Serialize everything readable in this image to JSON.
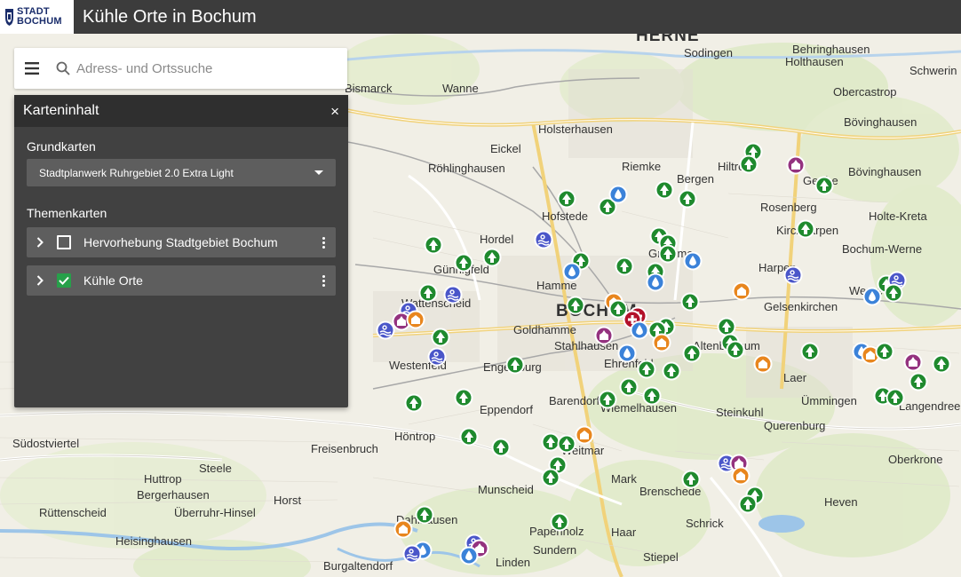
{
  "header": {
    "logo_line1": "STADT",
    "logo_line2": "BOCHUM",
    "title": "Kühle Orte in Bochum"
  },
  "search": {
    "placeholder": "Adress- und Ortssuche"
  },
  "panel": {
    "title": "Karteninhalt",
    "close": "×",
    "basemaps_label": "Grundkarten",
    "basemap_selected": "Stadtplanwerk Ruhrgebiet 2.0 Extra Light",
    "themes_label": "Themenkarten",
    "layers": [
      {
        "label": "Hervorhebung Stadtgebiet Bochum",
        "checked": false
      },
      {
        "label": "Kühle Orte",
        "checked": true
      }
    ]
  },
  "colors": {
    "header_bg": "#3c3c3c",
    "panel_bg": "#414141",
    "row_bg": "#5e5e5e",
    "check_green": "#27a04a",
    "pin_green": "#1f8a2e",
    "pin_blue_water": "#3b82d9",
    "pin_pool": "#4a56c9",
    "pin_orange": "#e8861e",
    "pin_purple": "#94327f",
    "pin_red": "#b3112a"
  },
  "map": {
    "labels": [
      {
        "text": "HERNE",
        "big": true
      },
      {
        "text": "Sodingen"
      },
      {
        "text": "Behringhausen"
      },
      {
        "text": "Holthausen"
      },
      {
        "text": "Schwerin"
      },
      {
        "text": "Bismarck"
      },
      {
        "text": "Wanne"
      },
      {
        "text": "Obercastrop"
      },
      {
        "text": "Bövinghausen"
      },
      {
        "text": "Holsterhausen"
      },
      {
        "text": "Eickel"
      },
      {
        "text": "Röhlinghausen"
      },
      {
        "text": "Riemke"
      },
      {
        "text": "Bergen"
      },
      {
        "text": "Hiltrop"
      },
      {
        "text": "Gerthe"
      },
      {
        "text": "Bövinghausen"
      },
      {
        "text": "Hofstede"
      },
      {
        "text": "Rosenberg"
      },
      {
        "text": "Kirchharpen"
      },
      {
        "text": "Hordel"
      },
      {
        "text": "Grumme"
      },
      {
        "text": "Harpen"
      },
      {
        "text": "Günnigfeld"
      },
      {
        "text": "Hamme"
      },
      {
        "text": "Wattenscheid"
      },
      {
        "text": "BOCHUM",
        "big": true
      },
      {
        "text": "Goldhamme"
      },
      {
        "text": "Stahlhausen"
      },
      {
        "text": "Altenbochum"
      },
      {
        "text": "Westenfeld"
      },
      {
        "text": "Engelsburg"
      },
      {
        "text": "Ehrenfeld"
      },
      {
        "text": "Laer"
      },
      {
        "text": "Langendreer"
      },
      {
        "text": "Eppendorf"
      },
      {
        "text": "Wiemelhausen"
      },
      {
        "text": "Ümmingen"
      },
      {
        "text": "Südostviertel"
      },
      {
        "text": "Freisenbruch"
      },
      {
        "text": "Höntrop"
      },
      {
        "text": "Weitmar"
      },
      {
        "text": "Querenburg"
      },
      {
        "text": "Steele"
      },
      {
        "text": "Huttrop"
      },
      {
        "text": "Bergerhausen"
      },
      {
        "text": "Mark"
      },
      {
        "text": "Brenschede"
      },
      {
        "text": "Rüttenscheid"
      },
      {
        "text": "Überruhr-Hinsel"
      },
      {
        "text": "Horst"
      },
      {
        "text": "Dahlhausen"
      },
      {
        "text": "Heven"
      },
      {
        "text": "Schrick"
      },
      {
        "text": "Haar"
      },
      {
        "text": "Stiepel"
      },
      {
        "text": "Linden"
      },
      {
        "text": "Burgaltendorf"
      },
      {
        "text": "Heisinghausen"
      },
      {
        "text": "Oberkrone"
      },
      {
        "text": "Papenholz"
      },
      {
        "text": "Holte-Kreta"
      },
      {
        "text": "Bochum-Werne"
      },
      {
        "text": "Werne"
      },
      {
        "text": "Sundern"
      },
      {
        "text": "Munscheid"
      },
      {
        "text": "Barendorf"
      },
      {
        "text": "Steinkuhl"
      },
      {
        "text": "Gelsenkirchen"
      }
    ]
  }
}
